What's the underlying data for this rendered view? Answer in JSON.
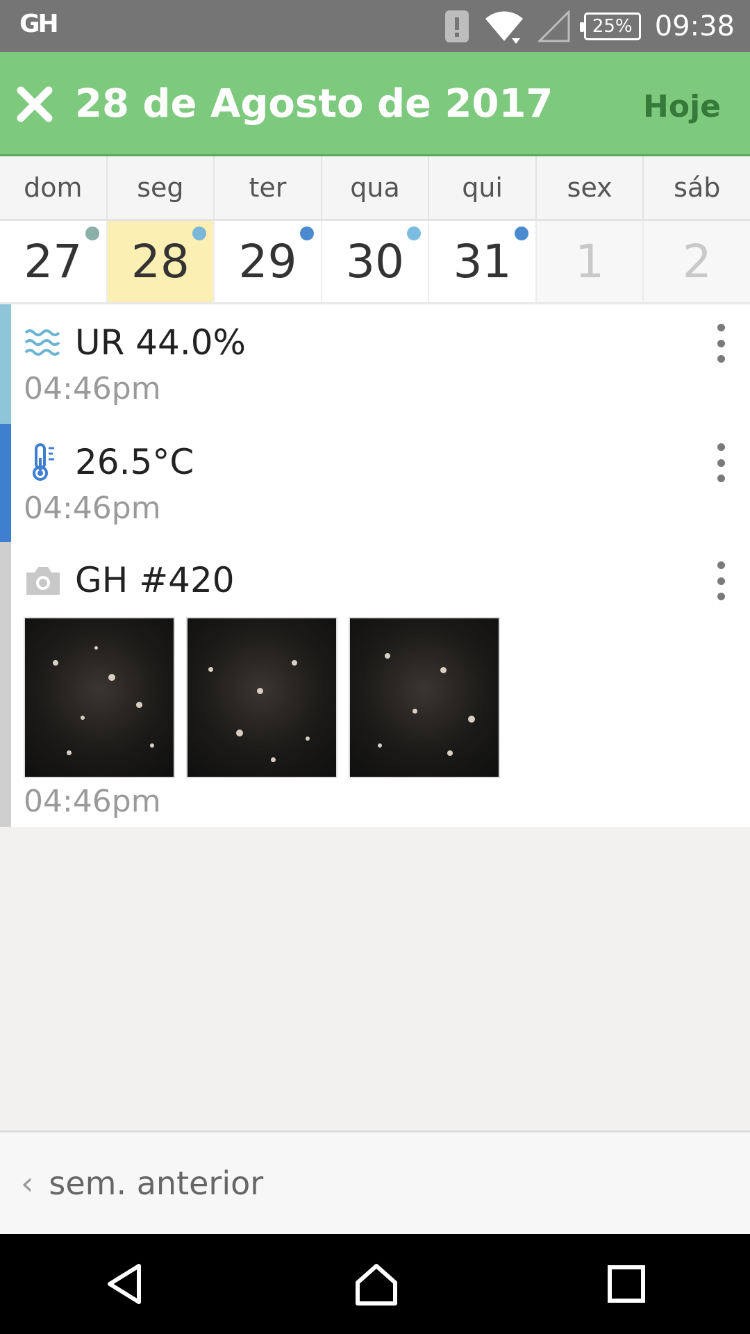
{
  "status_bar": {
    "logo": "GH",
    "battery": "25%",
    "time": "09:38"
  },
  "header": {
    "title": "28 de Agosto de 2017",
    "today_label": "Hoje"
  },
  "calendar": {
    "weekdays": [
      "dom",
      "seg",
      "ter",
      "qua",
      "qui",
      "sex",
      "sáb"
    ],
    "days": [
      {
        "label": "27",
        "dot_color": "#8ab0a8"
      },
      {
        "label": "28",
        "dot_color": "#7bb7d8",
        "selected": true
      },
      {
        "label": "29",
        "dot_color": "#4a8bd0"
      },
      {
        "label": "30",
        "dot_color": "#7bbde0"
      },
      {
        "label": "31",
        "dot_color": "#4a8bd0"
      },
      {
        "label": "1",
        "muted": true
      },
      {
        "label": "2",
        "muted": true
      }
    ]
  },
  "entries": [
    {
      "type": "humidity",
      "icon": "humidity-icon",
      "title": "UR 44.0%",
      "time": "04:46pm",
      "bar_color": "#8ec5d9"
    },
    {
      "type": "temperature",
      "icon": "thermometer-icon",
      "title": "26.5°C",
      "time": "04:46pm",
      "bar_color": "#3f7fd0"
    },
    {
      "type": "photo",
      "icon": "camera-icon",
      "title": "GH #420",
      "time": "04:46pm",
      "bar_color": "#cfcfcf",
      "photo_count": 3
    }
  ],
  "footer": {
    "prev_week_label": "sem. anterior"
  },
  "colors": {
    "appbar": "#7dc97d",
    "today": "#357a38",
    "selected_day": "#fcefb4"
  }
}
